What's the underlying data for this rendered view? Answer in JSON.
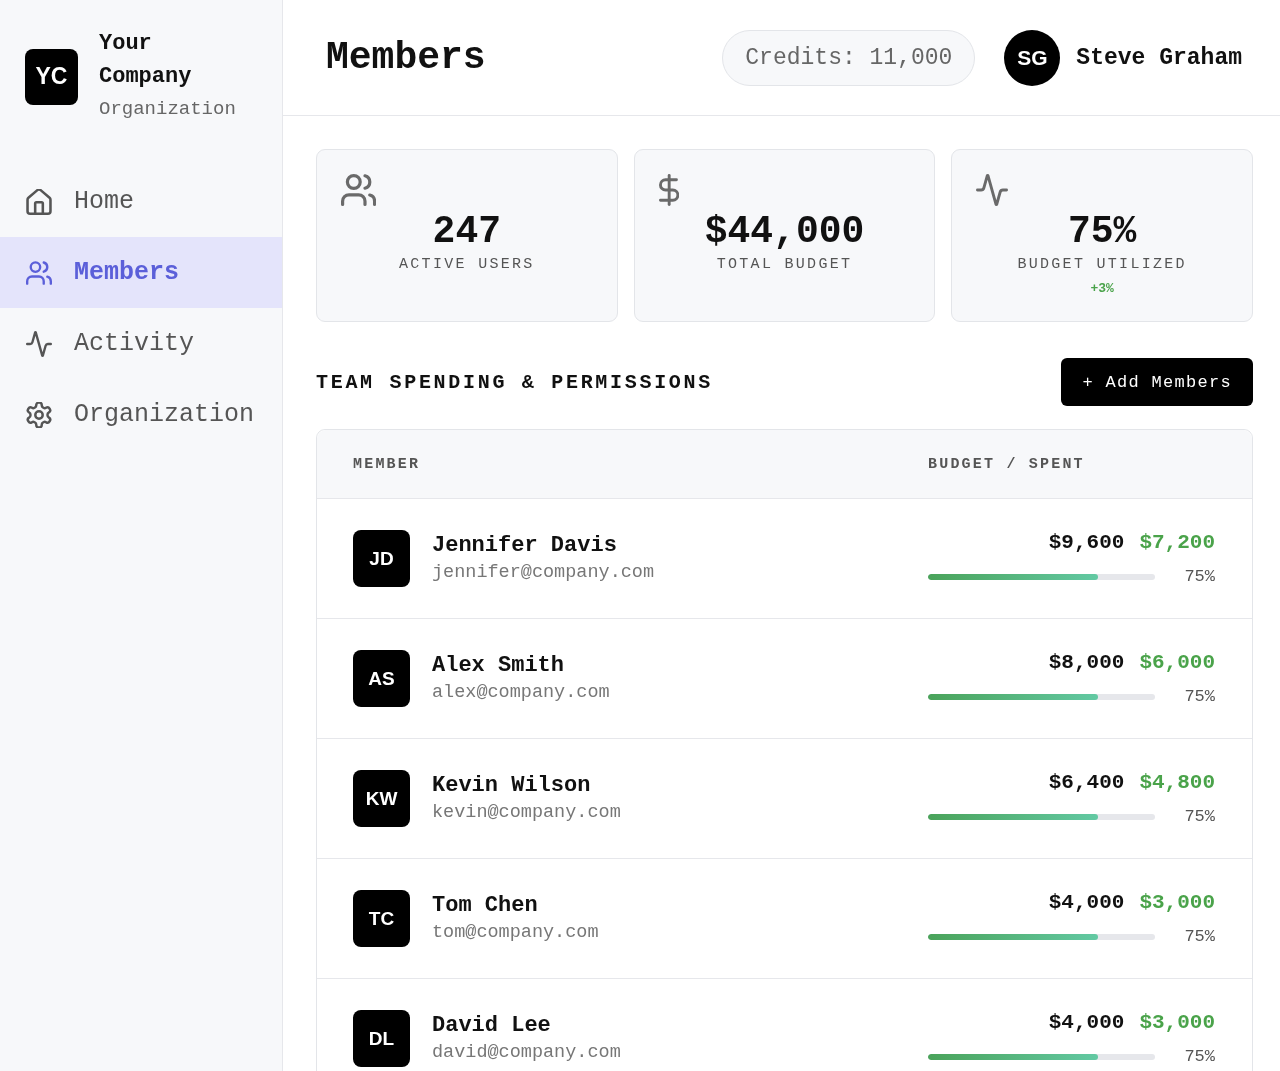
{
  "sidebar": {
    "logo": "YC",
    "company": "Your Company",
    "subtitle": "Organization",
    "nav": [
      {
        "kind": "home",
        "label": "Home",
        "selected": false
      },
      {
        "kind": "users",
        "label": "Members",
        "selected": true
      },
      {
        "kind": "activity",
        "label": "Activity",
        "selected": false
      },
      {
        "kind": "settings",
        "label": "Organization",
        "selected": false
      }
    ]
  },
  "header": {
    "title": "Members",
    "credits": "Credits: 11,000",
    "user": {
      "initials": "SG",
      "name": "Steve Graham"
    }
  },
  "stats": [
    {
      "kind": "users",
      "value": "247",
      "label": "ACTIVE USERS"
    },
    {
      "kind": "dollar",
      "value": "$44,000",
      "label": "TOTAL BUDGET"
    },
    {
      "kind": "activity",
      "value": "75%",
      "label": "BUDGET UTILIZED",
      "change": "+3%"
    }
  ],
  "team": {
    "title": "TEAM SPENDING & PERMISSIONS",
    "add_button": "+ Add Members",
    "columns": [
      "MEMBER",
      "BUDGET / SPENT"
    ],
    "rows": [
      {
        "initials": "JD",
        "name": "Jennifer Davis",
        "email": "jennifer@company.com",
        "budget": "$9,600",
        "spent": "$7,200",
        "level": 0.75,
        "percent": "75%"
      },
      {
        "initials": "AS",
        "name": "Alex Smith",
        "email": "alex@company.com",
        "budget": "$8,000",
        "spent": "$6,000",
        "level": 0.75,
        "percent": "75%"
      },
      {
        "initials": "KW",
        "name": "Kevin Wilson",
        "email": "kevin@company.com",
        "budget": "$6,400",
        "spent": "$4,800",
        "level": 0.75,
        "percent": "75%"
      },
      {
        "initials": "TC",
        "name": "Tom Chen",
        "email": "tom@company.com",
        "budget": "$4,000",
        "spent": "$3,000",
        "level": 0.75,
        "percent": "75%"
      },
      {
        "initials": "DL",
        "name": "David Lee",
        "email": "david@company.com",
        "budget": "$4,000",
        "spent": "$3,000",
        "level": 0.75,
        "percent": "75%"
      }
    ]
  }
}
